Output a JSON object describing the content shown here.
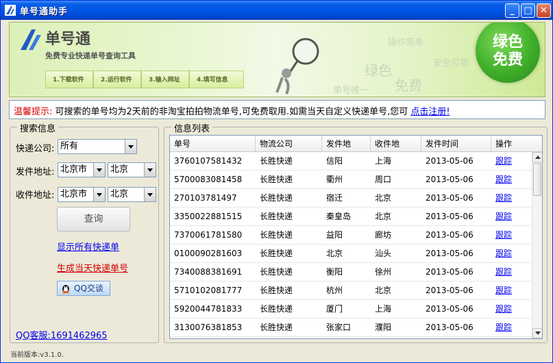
{
  "window": {
    "title": "单号通助手"
  },
  "banner": {
    "logo_name": "单号通",
    "tagline": "免费专业快递单号查询工具",
    "steps": [
      "1.下载软件",
      "2.运行软件",
      "3.输入网址",
      "4.填写信息"
    ],
    "watermarks": [
      "操作简单",
      "绿色",
      "安全可靠",
      "免费",
      "单号唯一"
    ],
    "badge_line1": "绿色",
    "badge_line2": "免费"
  },
  "notice": {
    "label": "温馨提示:",
    "text": "可搜索的单号均为2天前的非淘宝拍拍物流单号,可免费取用.如需当天自定义快递单号,您可",
    "link": "点击注册!"
  },
  "search": {
    "group_title": "搜索信息",
    "courier_label": "快递公司:",
    "courier_value": "所有",
    "sender_label": "发件地址:",
    "sender_province": "北京市",
    "sender_city": "北京",
    "receiver_label": "收件地址:",
    "receiver_province": "北京市",
    "receiver_city": "北京",
    "query_button": "查询",
    "show_all_link": "显示所有快递单",
    "generate_link": "生成当天快递单号",
    "qq_button": "QQ交谈",
    "qq_service": "QQ客服:1691462965"
  },
  "list": {
    "group_title": "信息列表",
    "columns": [
      "单号",
      "物流公司",
      "发件地",
      "收件地",
      "发件时间",
      "操作"
    ],
    "rows": [
      [
        "3760107581432",
        "长胜快递",
        "信阳",
        "上海",
        "2013-05-06",
        "跟踪"
      ],
      [
        "5700083081458",
        "长胜快递",
        "衢州",
        "周口",
        "2013-05-06",
        "跟踪"
      ],
      [
        "270103781497",
        "长胜快递",
        "宿迁",
        "北京",
        "2013-05-06",
        "跟踪"
      ],
      [
        "3350022881515",
        "长胜快递",
        "秦皇岛",
        "北京",
        "2013-05-06",
        "跟踪"
      ],
      [
        "7370061781580",
        "长胜快递",
        "益阳",
        "廊坊",
        "2013-05-06",
        "跟踪"
      ],
      [
        "0100090281603",
        "长胜快递",
        "北京",
        "汕头",
        "2013-05-06",
        "跟踪"
      ],
      [
        "7340088381691",
        "长胜快递",
        "衡阳",
        "徐州",
        "2013-05-06",
        "跟踪"
      ],
      [
        "5710102081777",
        "长胜快递",
        "杭州",
        "北京",
        "2013-05-06",
        "跟踪"
      ],
      [
        "5920044781833",
        "长胜快递",
        "厦门",
        "上海",
        "2013-05-06",
        "跟踪"
      ],
      [
        "3130076381853",
        "长胜快递",
        "张家口",
        "濮阳",
        "2013-05-06",
        "跟踪"
      ]
    ]
  },
  "status": {
    "version": "当前版本:v3.1.0."
  },
  "colors": {
    "accent": "#0055E5",
    "link": "#0000EE",
    "warning": "#D40000",
    "brand_green": "#3FAE2A"
  }
}
